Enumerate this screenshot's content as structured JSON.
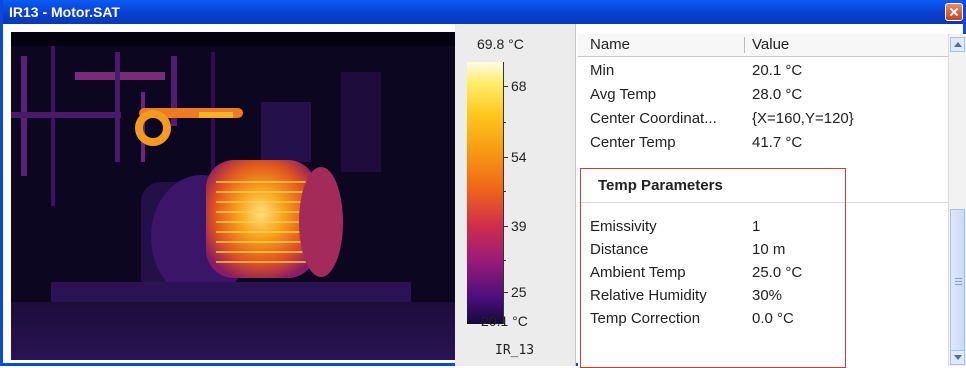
{
  "window": {
    "title": "IR13 - Motor.SAT"
  },
  "scale": {
    "max_label": "69.8 °C",
    "min_label": "20.1 °C",
    "ticks": [
      "68",
      "54",
      "39",
      "25"
    ],
    "image_name": "IR_13"
  },
  "properties": {
    "columns": {
      "name": "Name",
      "value": "Value"
    },
    "rows": [
      {
        "name": "Min",
        "value": "20.1 °C"
      },
      {
        "name": "Avg Temp",
        "value": "28.0 °C"
      },
      {
        "name": "Center Coordinat...",
        "value": "{X=160,Y=120}"
      },
      {
        "name": "Center Temp",
        "value": "41.7 °C"
      }
    ],
    "section_title": "Temp Parameters",
    "params": [
      {
        "name": "Emissivity",
        "value": "1"
      },
      {
        "name": "Distance",
        "value": "10 m"
      },
      {
        "name": "Ambient Temp",
        "value": "25.0 °C"
      },
      {
        "name": "Relative Humidity",
        "value": "30%"
      },
      {
        "name": "Temp Correction",
        "value": "0.0 °C"
      }
    ]
  },
  "colors": {
    "titlebar": "#0a4ad9",
    "highlight_box": "#d23a3a"
  }
}
